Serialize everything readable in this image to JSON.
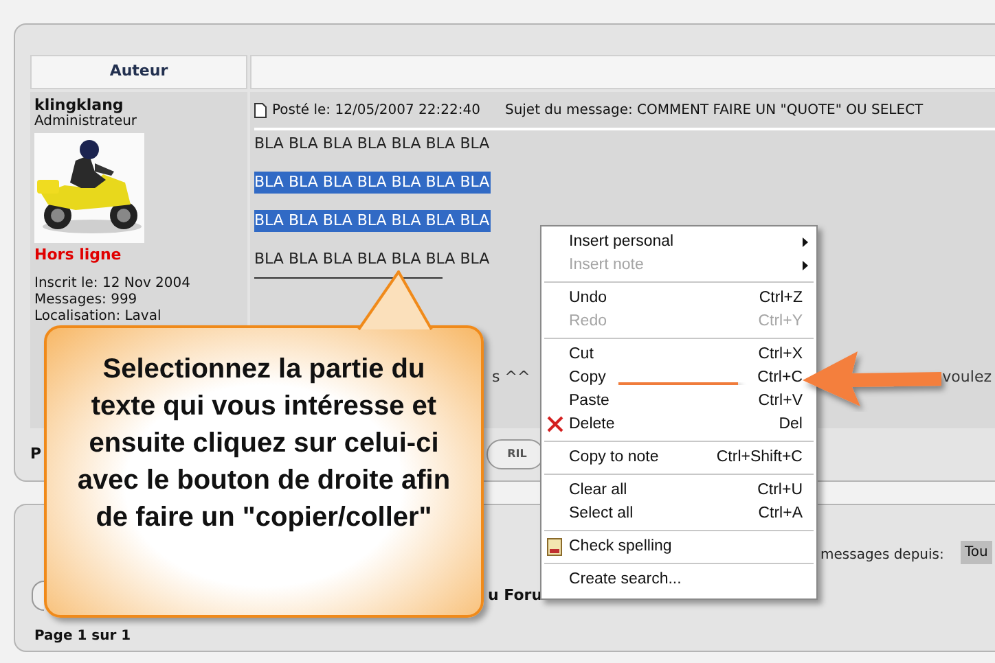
{
  "author_heading": "Auteur",
  "author": {
    "name": "klingklang",
    "rank": "Administrateur",
    "status": "Hors ligne",
    "online": false,
    "joined": "Inscrit le: 12 Nov 2004",
    "messages": "Messages: 999",
    "location": "Localisation: Laval"
  },
  "post": {
    "posted": "Posté le: 12/05/2007 22:22:40",
    "subject": "Sujet du message: COMMENT FAIRE UN \"QUOTE\" OU SELECT",
    "lines": [
      {
        "text": "BLA BLA BLA BLA BLA BLA BLA",
        "selected": false
      },
      {
        "text": "BLA BLA BLA BLA BLA BLA BLA",
        "selected": true
      },
      {
        "text": "BLA BLA BLA BLA BLA BLA BLA",
        "selected": true
      },
      {
        "text": "BLA BLA BLA BLA BLA BLA BLA",
        "selected": false
      }
    ],
    "hidden_line_start": "s ^^",
    "hidden_line_end": "voulez"
  },
  "post_footer": {
    "label": "P",
    "button": "RIL"
  },
  "bottom_panel": {
    "forum_link": "u Foru",
    "sort_label": "messages depuis:",
    "sort_value": "Tou",
    "page": "Page 1 sur 1"
  },
  "context_menu": {
    "groups": [
      {
        "items": [
          {
            "kind": "plain",
            "label": "Insert personal",
            "submenu": true,
            "disabled": false
          },
          {
            "kind": "plain",
            "label": "Insert note",
            "submenu": true,
            "disabled": true
          }
        ]
      },
      {
        "items": [
          {
            "kind": "plain",
            "label": "Undo",
            "shortcut": "Ctrl+Z",
            "disabled": false
          },
          {
            "kind": "plain",
            "label": "Redo",
            "shortcut": "Ctrl+Y",
            "disabled": true
          }
        ]
      },
      {
        "items": [
          {
            "kind": "plain",
            "label": "Cut",
            "shortcut": "Ctrl+X",
            "disabled": false
          },
          {
            "kind": "plain",
            "label": "Copy",
            "shortcut": "Ctrl+C",
            "disabled": false
          },
          {
            "kind": "plain",
            "label": "Paste",
            "shortcut": "Ctrl+V",
            "disabled": false
          },
          {
            "kind": "delete",
            "label": "Delete",
            "shortcut": "Del",
            "disabled": false
          }
        ]
      },
      {
        "items": [
          {
            "kind": "plain",
            "label": "Copy to note",
            "shortcut": "Ctrl+Shift+C",
            "disabled": false
          }
        ]
      },
      {
        "items": [
          {
            "kind": "plain",
            "label": "Clear all",
            "shortcut": "Ctrl+U",
            "disabled": false
          },
          {
            "kind": "plain",
            "label": "Select all",
            "shortcut": "Ctrl+A",
            "disabled": false
          }
        ]
      },
      {
        "items": [
          {
            "kind": "spelling",
            "label": "Check spelling",
            "disabled": false
          }
        ]
      },
      {
        "items": [
          {
            "kind": "plain",
            "label": "Create search...",
            "disabled": false
          }
        ]
      }
    ]
  },
  "callout": {
    "text": "Selectionnez la partie du texte qui vous intéresse et ensuite cliquez sur celui-ci avec le bouton de droite afin de faire un \"copier/coller\""
  }
}
